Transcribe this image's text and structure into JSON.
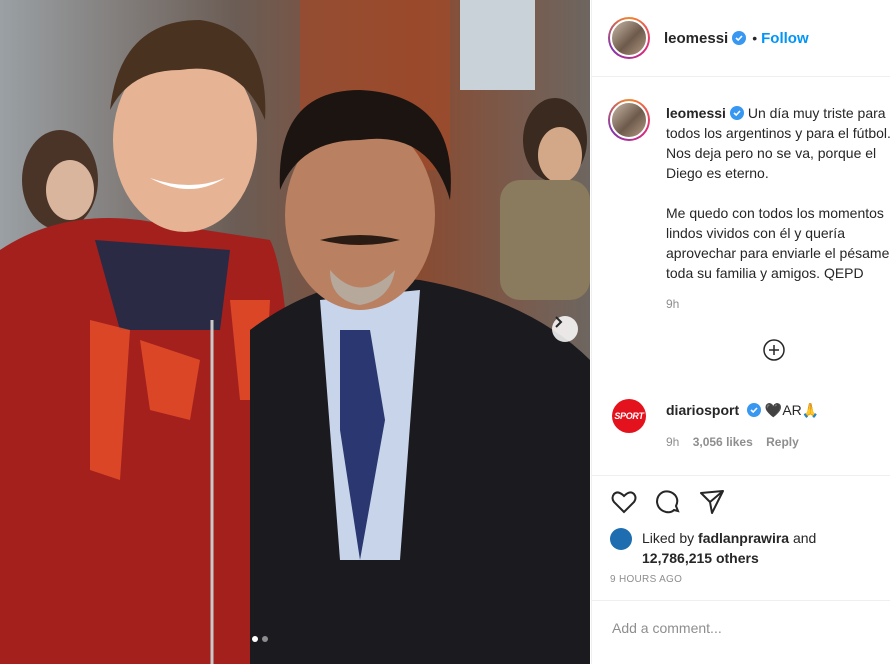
{
  "post": {
    "username": "leomessi",
    "follow_label": "Follow",
    "bullet": "•",
    "caption_line1": "Un día muy triste para",
    "caption_rest": "todos los argentinos y para el fútbol.\nNos deja pero no se va, porque el\nDiego es eterno.\n\nMe quedo con todos los momentos\nlindos vividos con él y quería\naprovechar para enviarle el pésame a\ntoda su familia y amigos. QEPD",
    "time": "9h"
  },
  "reply": {
    "avatar_text": "SPORT",
    "username": "diariosport",
    "text": "🖤AR🙏",
    "time": "9h",
    "likes": "3,056 likes",
    "reply_label": "Reply"
  },
  "likes": {
    "prefix": "Liked by",
    "user": "fadlanprawira",
    "and": "and",
    "others": "12,786,215 others"
  },
  "timestamp": "9 HOURS AGO",
  "comment_input": {
    "placeholder": "Add a comment..."
  },
  "icons": [
    "verified-icon",
    "heart-icon",
    "comment-icon",
    "share-icon",
    "next-icon",
    "load-more-icon"
  ],
  "colors": {
    "accent": "#0095f6",
    "sport_red": "#e4121c",
    "muted": "#8e8e8e"
  }
}
